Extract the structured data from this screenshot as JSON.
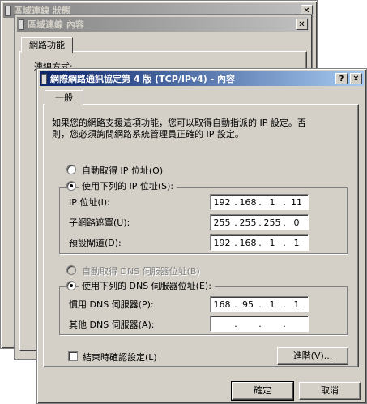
{
  "bg_window_1": {
    "title": "區域連線 狀態",
    "close": "✕"
  },
  "bg_window_2": {
    "title": "區域連線 內容",
    "close": "✕",
    "tab": "網路功能",
    "partial_label": "連線方式:"
  },
  "dialog": {
    "title": "網際網路通訊協定第 4 版 (TCP/IPv4) - 內容",
    "help_btn": "?",
    "close_btn": "✕",
    "tab_general": "一般",
    "description": [
      "如果您的網路支援這項功能，您可以取得自動指派的 IP 設定。否",
      "則，您必須詢問網路系統管理員正確的 IP 設定。"
    ],
    "auto_ip_label": "自動取得 IP 位址(O)",
    "manual_ip_label": "使用下列的 IP 位址(S):",
    "ip_label": "IP 位址(I):",
    "ip_value": [
      "192",
      "168",
      "1",
      "11"
    ],
    "mask_label": "子網路遮罩(U):",
    "mask_value": [
      "255",
      "255",
      "255",
      "0"
    ],
    "gateway_label": "預設閘道(D):",
    "gateway_value": [
      "192",
      "168",
      "1",
      "1"
    ],
    "auto_dns_label": "自動取得 DNS 伺服器位址(B)",
    "manual_dns_label": "使用下列的 DNS 伺服器位址(E):",
    "pref_dns_label": "慣用 DNS 伺服器(P):",
    "pref_dns_value": [
      "168",
      "95",
      "1",
      "1"
    ],
    "alt_dns_label": "其他 DNS 伺服器(A):",
    "alt_dns_value": [
      "",
      "",
      "",
      ""
    ],
    "validate_label": "結束時確認設定(L)",
    "advanced_btn": "進階(V)...",
    "ok_btn": "確定",
    "cancel_btn": "取消",
    "ip_dot": "."
  }
}
